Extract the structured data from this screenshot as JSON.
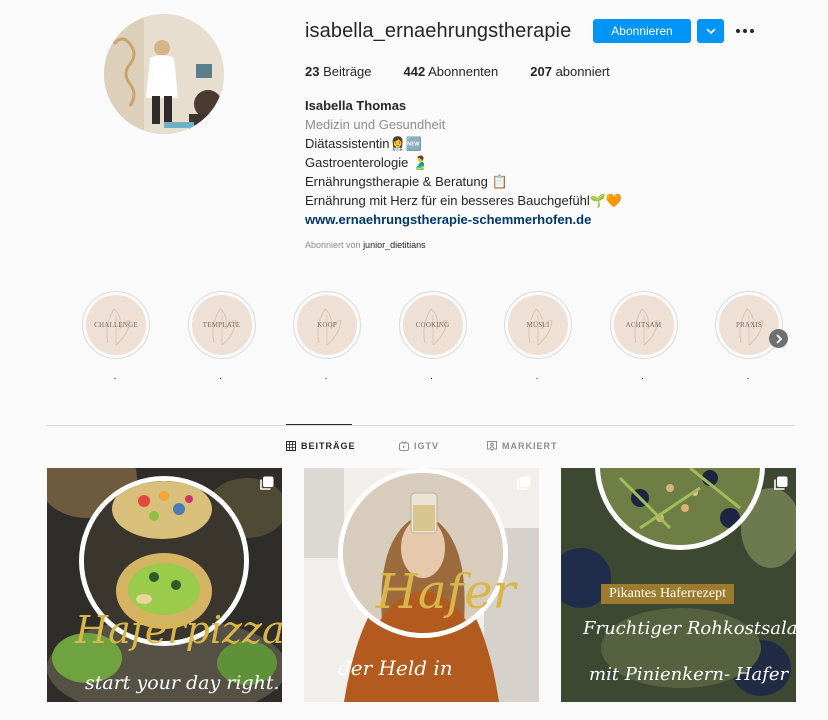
{
  "profile": {
    "username": "isabella_ernaehrungstherapie",
    "follow_label": "Abonnieren",
    "stats": {
      "posts_count": "23",
      "posts_label": "Beiträge",
      "followers_count": "442",
      "followers_label": "Abonnenten",
      "following_count": "207",
      "following_label": "abonniert"
    },
    "bio": {
      "name": "Isabella Thomas",
      "category": "Medizin und Gesundheit",
      "lines": [
        "Diätassistentin👩‍⚕️🆕",
        "Gastroenterologie 🫃",
        "Ernährungstherapie & Beratung 📋",
        "Ernährung mit Herz für ein besseres Bauchgefühl🌱🧡"
      ],
      "website": "www.ernaehrungstherapie-schemmerhofen.de",
      "followed_by_prefix": "Abonniert von",
      "followed_by_user": "junior_dietitians"
    }
  },
  "highlights": [
    {
      "label": "Challenge",
      "caption": "."
    },
    {
      "label": "Template",
      "caption": "."
    },
    {
      "label": "Koop",
      "caption": "."
    },
    {
      "label": "Cooking",
      "caption": "."
    },
    {
      "label": "Müsli",
      "caption": "."
    },
    {
      "label": "Achtsam",
      "caption": "."
    },
    {
      "label": "Praxis",
      "caption": "."
    }
  ],
  "tabs": [
    {
      "label": "BEITRÄGE",
      "icon": "grid-icon",
      "active": true
    },
    {
      "label": "IGTV",
      "icon": "igtv-icon",
      "active": false
    },
    {
      "label": "MARKIERT",
      "icon": "tagged-icon",
      "active": false
    }
  ],
  "posts": [
    {
      "title": "Haferpizza",
      "subtitle": "start your day right."
    },
    {
      "title": "Hafer",
      "subtitle": "der Held in"
    },
    {
      "banner": "Pikantes Haferrezept",
      "title": "Fruchtiger Rohkostsalat",
      "subtitle": "mit Pinienkern- Hafer"
    }
  ],
  "colors": {
    "accent": "#0095f6",
    "link": "#00376b",
    "highlight_bg": "#efe0d5",
    "script_gold": "#d9b64a"
  }
}
